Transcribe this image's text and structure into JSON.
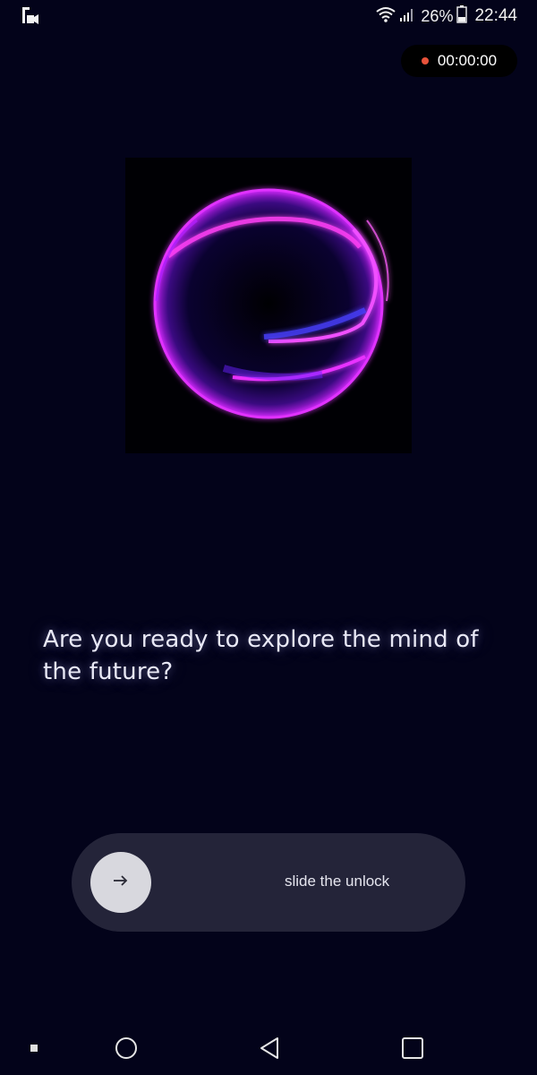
{
  "status_bar": {
    "battery_percent": "26%",
    "time": "22:44",
    "icons": [
      "screen-record-icon",
      "wifi-icon",
      "signal-icon",
      "battery-icon"
    ]
  },
  "recording": {
    "timer": "00:00:00",
    "dot_color": "#e8523a"
  },
  "main": {
    "headline": "Are you ready to explore the mind of the future?",
    "orb_colors": [
      "#ff2cf0",
      "#b020ff",
      "#3a1cff"
    ]
  },
  "slider": {
    "label": "slide the unlock",
    "knob_icon": "arrow-right-icon"
  },
  "nav_bar": {
    "icons": [
      "notification-dot-icon",
      "home-icon",
      "back-icon",
      "recents-icon"
    ]
  },
  "colors": {
    "background": "#03031a",
    "slider_track": "#242439",
    "slider_knob": "#d8d8de"
  }
}
